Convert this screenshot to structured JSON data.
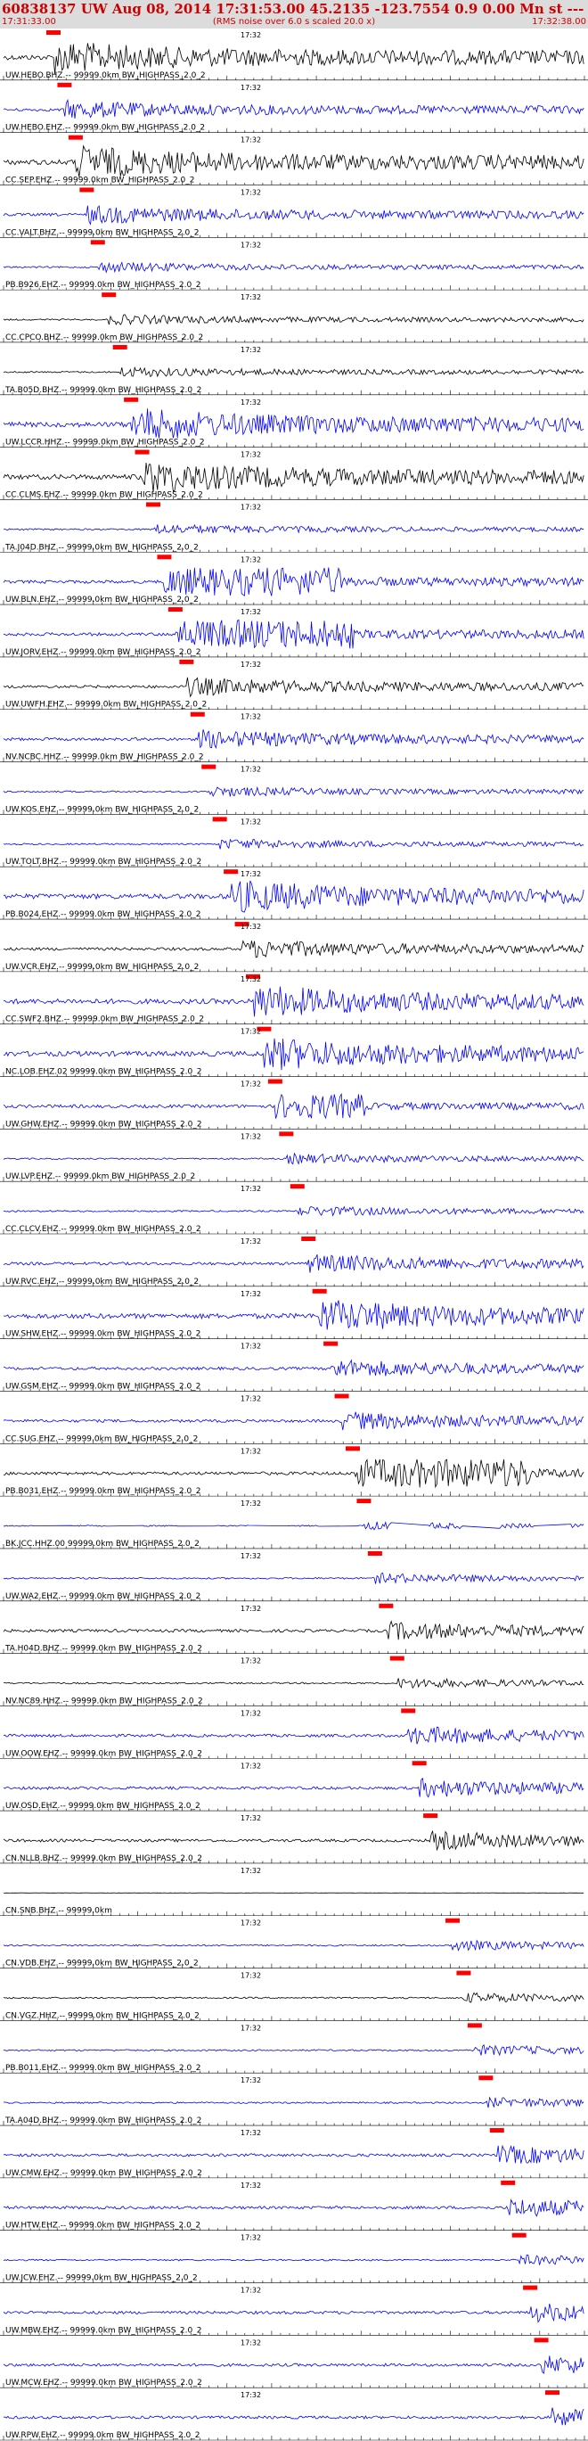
{
  "header": {
    "title": "60838137 UW Aug 08, 2014 17:31:53.00    45.2135 -123.7554  0.9 0.00 Mn st --- --- --   -1",
    "start_time": "17:31:33.00",
    "rms_note": "(RMS noise over 6.0 s scaled 20.0 x)",
    "end_time": "17:32:38.00"
  },
  "minute_label": "17:32",
  "colors": {
    "primary": "#0000ff",
    "alt": "#000000",
    "pick": "#ff0000",
    "grid": "#000000",
    "header_bg": "#dcdcdc",
    "header_text": "#cc0000"
  },
  "chart_data": {
    "type": "line",
    "title": "60838137 UW Aug 08, 2014 17:31:53.00    45.2135 -123.7554  0.9 0.00 Mn st --- --- --   -1",
    "xlabel": "",
    "ylabel": "",
    "x_range": [
      "17:31:33.00",
      "17:32:38.00"
    ],
    "grid": true,
    "series": [
      {
        "name": "UW.HEBO.BHZ.-- 99999.0km BW_HIGHPASS_2.0_2",
        "color": "#000000",
        "activity": "high"
      },
      {
        "name": "UW.HEBO.EHZ.-- 99999.0km BW_HIGHPASS_2.0_2",
        "color": "#0000ff",
        "activity": "medium"
      },
      {
        "name": "CC.SEP.EHZ.-- 99999.0km BW_HIGHPASS_2.0_2",
        "color": "#000000",
        "activity": "high"
      },
      {
        "name": "CC.VALT.BHZ.-- 99999.0km BW_HIGHPASS_2.0_2",
        "color": "#0000ff",
        "activity": "medium"
      },
      {
        "name": "PB.B926.EHZ.-- 99999.0km BW_HIGHPASS_2.0_2",
        "color": "#0000ff",
        "activity": "low"
      },
      {
        "name": "CC.CPCO.BHZ.-- 99999.0km BW_HIGHPASS_2.0_2",
        "color": "#000000",
        "activity": "low"
      },
      {
        "name": "TA.B05D.BHZ.-- 99999.0km BW_HIGHPASS_2.0_2",
        "color": "#000000",
        "activity": "low"
      },
      {
        "name": "UW.LCCR.HHZ.-- 99999.0km BW_HIGHPASS_2.0_2",
        "color": "#0000ff",
        "activity": "high"
      },
      {
        "name": "CC.CLMS.EHZ.-- 99999.0km BW_HIGHPASS_2.0_2",
        "color": "#000000",
        "activity": "high"
      },
      {
        "name": "TA.J04D.BHZ.-- 99999.0km BW_HIGHPASS_2.0_2",
        "color": "#0000ff",
        "activity": "low"
      },
      {
        "name": "UW.BLN.EHZ.-- 99999.0km BW_HIGHPASS_2.0_2",
        "color": "#0000ff",
        "activity": "burst"
      },
      {
        "name": "UW.JORV.EHZ.-- 99999.0km BW_HIGHPASS_2.0_2",
        "color": "#0000ff",
        "activity": "burst"
      },
      {
        "name": "UW.UWFH.EHZ.-- 99999.0km BW_HIGHPASS_2.0_2",
        "color": "#000000",
        "activity": "medium"
      },
      {
        "name": "NV.NCBC.HHZ.-- 99999.0km BW_HIGHPASS_2.0_2",
        "color": "#0000ff",
        "activity": "medium"
      },
      {
        "name": "UW.KOS.EHZ.-- 99999.0km BW_HIGHPASS_2.0_2",
        "color": "#0000ff",
        "activity": "low"
      },
      {
        "name": "UW.TOLT.BHZ.-- 99999.0km BW_HIGHPASS_2.0_2",
        "color": "#0000ff",
        "activity": "low"
      },
      {
        "name": "PB.B024.EHZ.-- 99999.0km BW_HIGHPASS_2.0_2",
        "color": "#0000ff",
        "activity": "high"
      },
      {
        "name": "UW.VCR.EHZ.-- 99999.0km BW_HIGHPASS_2.0_2",
        "color": "#000000",
        "activity": "medium"
      },
      {
        "name": "CC.SWF2.BHZ.-- 99999.0km BW_HIGHPASS_2.0_2",
        "color": "#0000ff",
        "activity": "high"
      },
      {
        "name": "NC.LOB.EHZ.02 99999.0km BW_HIGHPASS_2.0_2",
        "color": "#0000ff",
        "activity": "high"
      },
      {
        "name": "UW.GHW.EHZ.-- 99999.0km BW_HIGHPASS_2.0_2",
        "color": "#0000ff",
        "activity": "clip"
      },
      {
        "name": "UW.LVP.EHZ.-- 99999.0km BW_HIGHPASS_2.0_2",
        "color": "#0000ff",
        "activity": "low"
      },
      {
        "name": "CC.CLCV.EHZ.-- 99999.0km BW_HIGHPASS_2.0_2",
        "color": "#0000ff",
        "activity": "low"
      },
      {
        "name": "UW.RVC.EHZ.-- 99999.0km BW_HIGHPASS_2.0_2",
        "color": "#0000ff",
        "activity": "medium"
      },
      {
        "name": "UW.SHW.EHZ.-- 99999.0km BW_HIGHPASS_2.0_2",
        "color": "#0000ff",
        "activity": "high"
      },
      {
        "name": "UW.GSM.EHZ.-- 99999.0km BW_HIGHPASS_2.0_2",
        "color": "#0000ff",
        "activity": "medium"
      },
      {
        "name": "CC.SUG.EHZ.-- 99999.0km BW_HIGHPASS_2.0_2",
        "color": "#0000ff",
        "activity": "medium"
      },
      {
        "name": "PB.B031.EHZ.-- 99999.0km BW_HIGHPASS_2.0_2",
        "color": "#000000",
        "activity": "burst"
      },
      {
        "name": "BK.JCC.HHZ.00 99999.0km BW_HIGHPASS_2.0_2",
        "color": "#0000ff",
        "activity": "gappy"
      },
      {
        "name": "UW.WA2.EHZ.-- 99999.0km BW_HIGHPASS_2.0_2",
        "color": "#0000ff",
        "activity": "low"
      },
      {
        "name": "TA.H04D.BHZ.-- 99999.0km BW_HIGHPASS_2.0_2",
        "color": "#000000",
        "activity": "medium"
      },
      {
        "name": "NV.NC89.HHZ.-- 99999.0km BW_HIGHPASS_2.0_2",
        "color": "#000000",
        "activity": "low"
      },
      {
        "name": "UW.OOW.EHZ.-- 99999.0km BW_HIGHPASS_2.0_2",
        "color": "#0000ff",
        "activity": "medium"
      },
      {
        "name": "UW.OSD.EHZ.-- 99999.0km BW_HIGHPASS_2.0_2",
        "color": "#0000ff",
        "activity": "medium"
      },
      {
        "name": "CN.NLLB.BHZ.-- 99999.0km BW_HIGHPASS_2.0_2",
        "color": "#000000",
        "activity": "medium"
      },
      {
        "name": "CN.SNB.BHZ.-- 99999.0km",
        "color": "#000000",
        "activity": "flat"
      },
      {
        "name": "CN.VDB.EHZ.-- 99999.0km BW_HIGHPASS_2.0_2",
        "color": "#0000ff",
        "activity": "low"
      },
      {
        "name": "CN.VGZ.HHZ.-- 99999.0km BW_HIGHPASS_2.0_2",
        "color": "#000000",
        "activity": "low"
      },
      {
        "name": "PB.B011.EHZ.-- 99999.0km BW_HIGHPASS_2.0_2",
        "color": "#0000ff",
        "activity": "low"
      },
      {
        "name": "TA.A04D.BHZ.-- 99999.0km BW_HIGHPASS_2.0_2",
        "color": "#0000ff",
        "activity": "low"
      },
      {
        "name": "UW.CMW.EHZ.-- 99999.0km BW_HIGHPASS_2.0_2",
        "color": "#0000ff",
        "activity": "medium"
      },
      {
        "name": "UW.HTW.EHZ.-- 99999.0km BW_HIGHPASS_2.0_2",
        "color": "#0000ff",
        "activity": "medium"
      },
      {
        "name": "UW.JCW.EHZ.-- 99999.0km BW_HIGHPASS_2.0_2",
        "color": "#0000ff",
        "activity": "low"
      },
      {
        "name": "UW.MBW.EHZ.-- 99999.0km BW_HIGHPASS_2.0_2",
        "color": "#0000ff",
        "activity": "medium"
      },
      {
        "name": "UW.MCW.EHZ.-- 99999.0km BW_HIGHPASS_2.0_2",
        "color": "#0000ff",
        "activity": "medium"
      },
      {
        "name": "UW.RPW.EHZ.-- 99999.0km BW_HIGHPASS_2.0_2",
        "color": "#0000ff",
        "activity": "medium"
      }
    ]
  }
}
